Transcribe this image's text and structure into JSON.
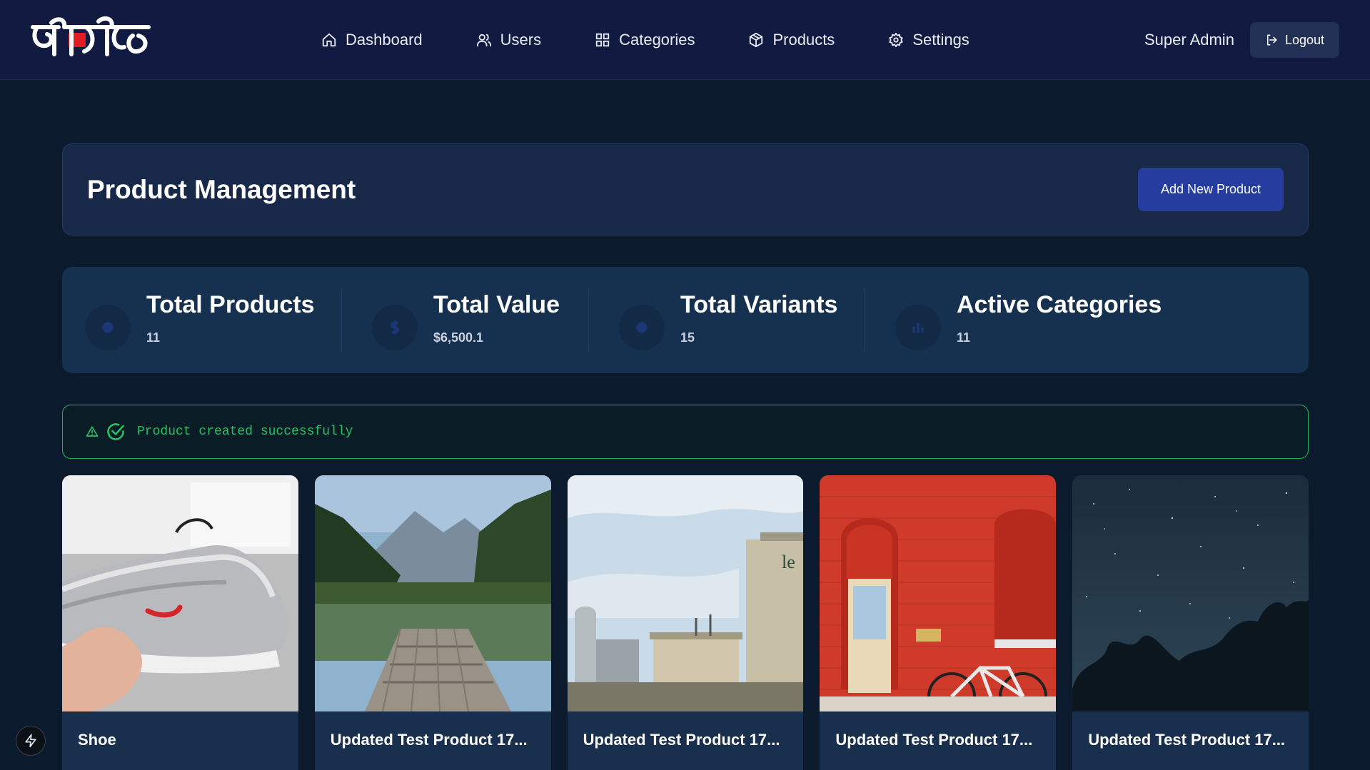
{
  "brand": {
    "logo_text": "নিবেদিত",
    "logo_icon": "brand-logo"
  },
  "nav": {
    "items": [
      {
        "label": "Dashboard",
        "icon": "home-icon"
      },
      {
        "label": "Users",
        "icon": "users-icon"
      },
      {
        "label": "Categories",
        "icon": "grid-icon"
      },
      {
        "label": "Products",
        "icon": "package-icon"
      },
      {
        "label": "Settings",
        "icon": "gear-icon"
      }
    ],
    "user_name": "Super Admin",
    "logout_label": "Logout"
  },
  "header": {
    "title": "Product Management",
    "add_button_label": "Add New Product"
  },
  "stats": [
    {
      "label": "Total Products",
      "value": "11",
      "icon": "package-icon"
    },
    {
      "label": "Total Value",
      "value": "$6,500.1",
      "icon": "dollar-icon"
    },
    {
      "label": "Total Variants",
      "value": "15",
      "icon": "layers-icon"
    },
    {
      "label": "Active Categories",
      "value": "11",
      "icon": "chart-icon"
    }
  ],
  "alert": {
    "message": "Product created successfully",
    "color": "#25c25f"
  },
  "products": [
    {
      "title": "Shoe",
      "image": "sneaker-photo"
    },
    {
      "title": "Updated Test Product 17...",
      "image": "lake-dock-photo"
    },
    {
      "title": "Updated Test Product 17...",
      "image": "industrial-tanks-photo"
    },
    {
      "title": "Updated Test Product 17...",
      "image": "red-wall-bicycle-photo"
    },
    {
      "title": "Updated Test Product 17...",
      "image": "night-sky-photo"
    }
  ],
  "colors": {
    "background": "#0b1a2c",
    "navbar": "#111b42",
    "primary_button": "#253d9e",
    "card": "#182f4e"
  }
}
